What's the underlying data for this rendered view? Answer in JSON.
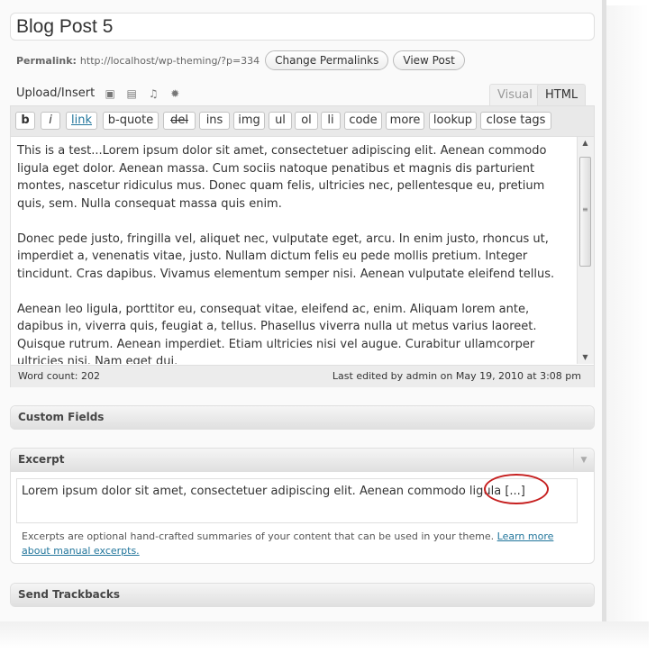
{
  "post": {
    "title": "Blog Post 5",
    "permalink_label": "Permalink:",
    "permalink_url": "http://localhost/wp-theming/?p=334",
    "change_permalinks": "Change Permalinks",
    "view_post": "View Post"
  },
  "upload": {
    "label": "Upload/Insert",
    "icons": [
      "image-icon",
      "video-icon",
      "audio-icon",
      "media-icon"
    ]
  },
  "tabs": {
    "visual": "Visual",
    "html": "HTML",
    "active": "HTML"
  },
  "quicktags": [
    "b",
    "i",
    "link",
    "b-quote",
    "del",
    "ins",
    "img",
    "ul",
    "ol",
    "li",
    "code",
    "more",
    "lookup",
    "close tags"
  ],
  "editor": {
    "paragraphs": [
      "This is a test...Lorem ipsum dolor sit amet, consectetuer adipiscing elit. Aenean commodo ligula eget dolor. Aenean massa. Cum sociis natoque penatibus et magnis dis parturient montes, nascetur ridiculus mus. Donec quam felis, ultricies nec, pellentesque eu, pretium quis, sem. Nulla consequat massa quis enim.",
      "Donec pede justo, fringilla vel, aliquet nec, vulputate eget, arcu. In enim justo, rhoncus ut, imperdiet a, venenatis vitae, justo. Nullam dictum felis eu pede mollis pretium. Integer tincidunt. Cras dapibus. Vivamus elementum semper nisi. Aenean vulputate eleifend tellus.",
      "Aenean leo ligula, porttitor eu, consequat vitae, eleifend ac, enim. Aliquam lorem ante, dapibus in, viverra quis, feugiat a, tellus. Phasellus viverra nulla ut metus varius laoreet. Quisque rutrum. Aenean imperdiet. Etiam ultricies nisi vel augue. Curabitur ullamcorper ultricies nisi. Nam eget dui."
    ]
  },
  "status": {
    "word_count": "Word count: 202",
    "last_edited": "Last edited by admin on May 19, 2010 at 3:08 pm"
  },
  "custom_fields": {
    "title": "Custom Fields"
  },
  "excerpt": {
    "title": "Excerpt",
    "text": "Lorem ipsum dolor sit amet, consectetuer adipiscing elit. Aenean commodo ligula [...]",
    "help_text": "Excerpts are optional hand-crafted summaries of your content that can be used in your theme.",
    "help_link": "Learn more about manual excerpts."
  },
  "trackbacks": {
    "title": "Send Trackbacks"
  },
  "colors": {
    "link": "#21759b",
    "annotation_circle": "#c62020"
  }
}
